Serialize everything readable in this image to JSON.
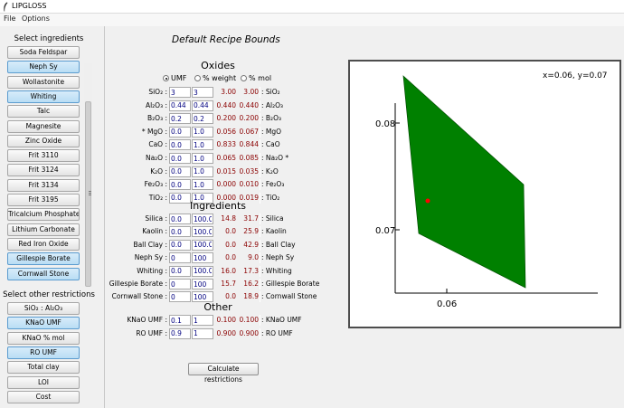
{
  "window": {
    "title": "LIPGLOSS"
  },
  "menu": {
    "file": "File",
    "options": "Options"
  },
  "ingredients_panel": {
    "heading": "Select ingredients",
    "items": [
      {
        "label": "Soda Feldspar",
        "selected": false
      },
      {
        "label": "Neph Sy",
        "selected": true
      },
      {
        "label": "Wollastonite",
        "selected": false
      },
      {
        "label": "Whiting",
        "selected": true
      },
      {
        "label": "Talc",
        "selected": false
      },
      {
        "label": "Magnesite",
        "selected": false
      },
      {
        "label": "Zinc Oxide",
        "selected": false
      },
      {
        "label": "Frit 3110",
        "selected": false
      },
      {
        "label": "Frit 3124",
        "selected": false
      },
      {
        "label": "Frit 3134",
        "selected": false
      },
      {
        "label": "Frit 3195",
        "selected": false
      },
      {
        "label": "Tricalcium Phosphate",
        "selected": false
      },
      {
        "label": "Lithium Carbonate",
        "selected": false
      },
      {
        "label": "Red Iron Oxide",
        "selected": false
      },
      {
        "label": "Gillespie Borate",
        "selected": true
      },
      {
        "label": "Cornwall Stone",
        "selected": true
      }
    ]
  },
  "restrictions_panel": {
    "heading": "Select other restrictions",
    "items": [
      {
        "label": "SiO₂ : Al₂O₃",
        "selected": false
      },
      {
        "label": "KNaO UMF",
        "selected": true
      },
      {
        "label": "KNaO % mol",
        "selected": false
      },
      {
        "label": "RO UMF",
        "selected": true
      },
      {
        "label": "Total clay",
        "selected": false
      },
      {
        "label": "LOI",
        "selected": false
      },
      {
        "label": "Cost",
        "selected": false
      }
    ]
  },
  "recipe": {
    "title": "Default Recipe Bounds",
    "oxides_heading": "Oxides",
    "radio": {
      "umf": "UMF",
      "weight": "% weight",
      "mol": "% mol",
      "selected": "umf"
    },
    "oxides": [
      {
        "label": "SiO₂ :",
        "lower": "3",
        "upper": "3",
        "calc_lower": "3.00",
        "calc_upper": "3.00",
        "rlabel": ": SiO₂"
      },
      {
        "label": "Al₂O₃ :",
        "lower": "0.44",
        "upper": "0.44",
        "calc_lower": "0.440",
        "calc_upper": "0.440",
        "rlabel": ": Al₂O₃"
      },
      {
        "label": "B₂O₃ :",
        "lower": "0.2",
        "upper": "0.2",
        "calc_lower": "0.200",
        "calc_upper": "0.200",
        "rlabel": ": B₂O₃"
      },
      {
        "label": "* MgO :",
        "lower": "0.0",
        "upper": "1.0",
        "calc_lower": "0.056",
        "calc_upper": "0.067",
        "rlabel": ": MgO"
      },
      {
        "label": "CaO :",
        "lower": "0.0",
        "upper": "1.0",
        "calc_lower": "0.833",
        "calc_upper": "0.844",
        "rlabel": ": CaO"
      },
      {
        "label": "Na₂O :",
        "lower": "0.0",
        "upper": "1.0",
        "calc_lower": "0.065",
        "calc_upper": "0.085",
        "rlabel": ": Na₂O *"
      },
      {
        "label": "K₂O :",
        "lower": "0.0",
        "upper": "1.0",
        "calc_lower": "0.015",
        "calc_upper": "0.035",
        "rlabel": ": K₂O"
      },
      {
        "label": "Fe₂O₃ :",
        "lower": "0.0",
        "upper": "1.0",
        "calc_lower": "0.000",
        "calc_upper": "0.010",
        "rlabel": ": Fe₂O₃"
      },
      {
        "label": "TiO₂ :",
        "lower": "0.0",
        "upper": "1.0",
        "calc_lower": "0.000",
        "calc_upper": "0.019",
        "rlabel": ": TiO₂"
      }
    ],
    "ingredients_heading": "Ingredients",
    "ingredients": [
      {
        "label": "Silica :",
        "lower": "0.0",
        "upper": "100.0",
        "calc_lower": "14.8",
        "calc_upper": "31.7",
        "rlabel": ": Silica"
      },
      {
        "label": "Kaolin :",
        "lower": "0.0",
        "upper": "100.0",
        "calc_lower": "0.0",
        "calc_upper": "25.9",
        "rlabel": ": Kaolin"
      },
      {
        "label": "Ball Clay :",
        "lower": "0.0",
        "upper": "100.0",
        "calc_lower": "0.0",
        "calc_upper": "42.9",
        "rlabel": ": Ball Clay"
      },
      {
        "label": "Neph Sy :",
        "lower": "0",
        "upper": "100",
        "calc_lower": "0.0",
        "calc_upper": "9.0",
        "rlabel": ": Neph Sy"
      },
      {
        "label": "Whiting :",
        "lower": "0.0",
        "upper": "100.0",
        "calc_lower": "16.0",
        "calc_upper": "17.3",
        "rlabel": ": Whiting"
      },
      {
        "label": "Gillespie Borate :",
        "lower": "0",
        "upper": "100",
        "calc_lower": "15.7",
        "calc_upper": "16.2",
        "rlabel": ": Gillespie Borate"
      },
      {
        "label": "Cornwall Stone :",
        "lower": "0",
        "upper": "100",
        "calc_lower": "0.0",
        "calc_upper": "18.9",
        "rlabel": ": Cornwall Stone"
      }
    ],
    "other_heading": "Other",
    "other": [
      {
        "label": "KNaO UMF :",
        "lower": "0.1",
        "upper": "1",
        "calc_lower": "0.100",
        "calc_upper": "0.100",
        "rlabel": ": KNaO UMF"
      },
      {
        "label": "RO UMF :",
        "lower": "0.9",
        "upper": "1",
        "calc_lower": "0.900",
        "calc_upper": "0.900",
        "rlabel": ": RO UMF"
      }
    ],
    "calculate_label": "Calculate restrictions"
  },
  "graph": {
    "coord_readout": "x=0.06, y=0.07",
    "region_color": "#008000",
    "point_color": "#ff0000",
    "x_ticks": [
      "0.06"
    ],
    "y_ticks": [
      "0.08",
      "0.07"
    ]
  }
}
